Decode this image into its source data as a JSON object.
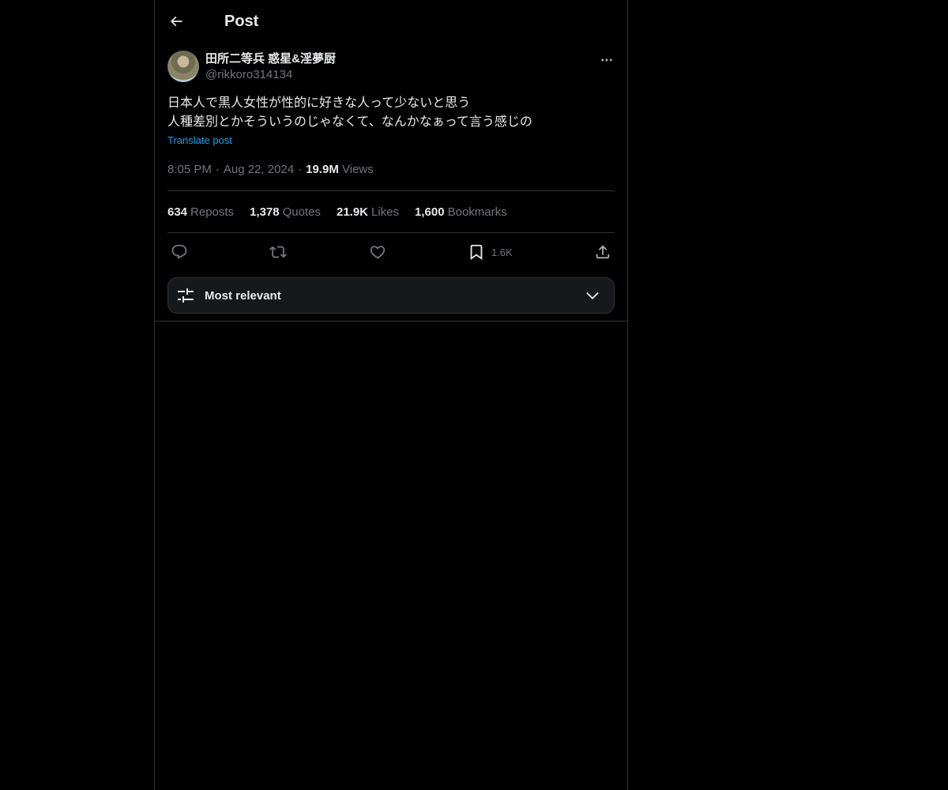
{
  "header": {
    "title": "Post"
  },
  "post": {
    "author": {
      "display_name": "田所二等兵 惑星&淫夢厨",
      "handle": "@rikkoro314134"
    },
    "text_lines": [
      "日本人で黒人女性が性的に好きな人って少ないと思う",
      "人種差別とかそういうのじゃなくて、なんかなぁって言う感じの"
    ],
    "translate_label": "Translate post",
    "time": "8:05 PM",
    "date": "Aug 22, 2024",
    "views_count": "19.9M",
    "views_label": "Views",
    "separator": "·"
  },
  "stats": {
    "reposts_count": "634",
    "reposts_label": "Reposts",
    "quotes_count": "1,378",
    "quotes_label": "Quotes",
    "likes_count": "21.9K",
    "likes_label": "Likes",
    "bookmarks_count": "1,600",
    "bookmarks_label": "Bookmarks"
  },
  "actions": {
    "reply_icon": "reply-icon",
    "repost_icon": "repost-icon",
    "like_icon": "heart-icon",
    "bookmark_icon": "bookmark-icon",
    "bookmark_count": "1.6K",
    "share_icon": "share-icon"
  },
  "sort": {
    "label": "Most relevant"
  },
  "colors": {
    "background": "#000000",
    "text_primary": "#e7e9ea",
    "text_secondary": "#71767b",
    "link": "#1d9bf0",
    "border": "#2f3336",
    "sort_bg": "#16181c"
  }
}
